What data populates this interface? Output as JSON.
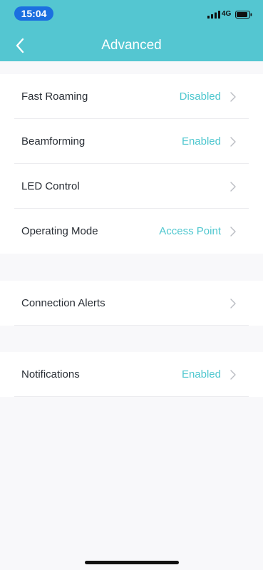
{
  "status_bar": {
    "time": "15:04",
    "network": "4G",
    "icons": [
      "signal-icon",
      "battery-icon"
    ]
  },
  "nav": {
    "title": "Advanced",
    "back_icon": "chevron-left-icon"
  },
  "groups": [
    {
      "rows": [
        {
          "label": "Fast Roaming",
          "value": "Disabled"
        },
        {
          "label": "Beamforming",
          "value": "Enabled"
        },
        {
          "label": "LED Control",
          "value": ""
        },
        {
          "label": "Operating Mode",
          "value": "Access Point"
        }
      ]
    },
    {
      "rows": [
        {
          "label": "Connection Alerts",
          "value": ""
        }
      ]
    },
    {
      "rows": [
        {
          "label": "Notifications",
          "value": "Enabled"
        }
      ]
    }
  ],
  "colors": {
    "header": "#54c6d1",
    "accent": "#4fc7cf",
    "time_pill": "#1b6fe0",
    "background": "#f8f8fa"
  }
}
